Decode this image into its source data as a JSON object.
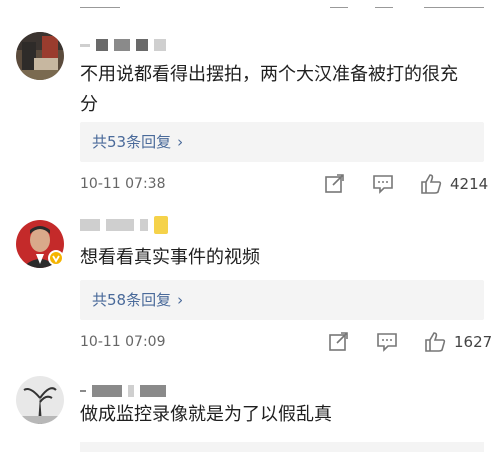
{
  "comments": [
    {
      "text_line1": "不用说都看得出摆拍，两个大汉准备被打的很充",
      "text_line2": "分",
      "replies_label": "共53条回复",
      "time": "10-11 07:38",
      "likes": "4214"
    },
    {
      "text_line1": "想看看真实事件的视频",
      "replies_label": "共58条回复",
      "time": "10-11 07:09",
      "likes": "1627"
    },
    {
      "text_line1": "做成监控录像就是为了以假乱真"
    }
  ],
  "icons": {
    "share": "share-icon",
    "comment": "comment-icon",
    "like": "thumbs-up-icon",
    "verified": "verified-badge-icon",
    "chevron": "chevron-right-icon"
  },
  "colors": {
    "link": "#4a6a9a",
    "reply_bg": "#f4f4f4",
    "verified_badge": "#f5b400"
  }
}
